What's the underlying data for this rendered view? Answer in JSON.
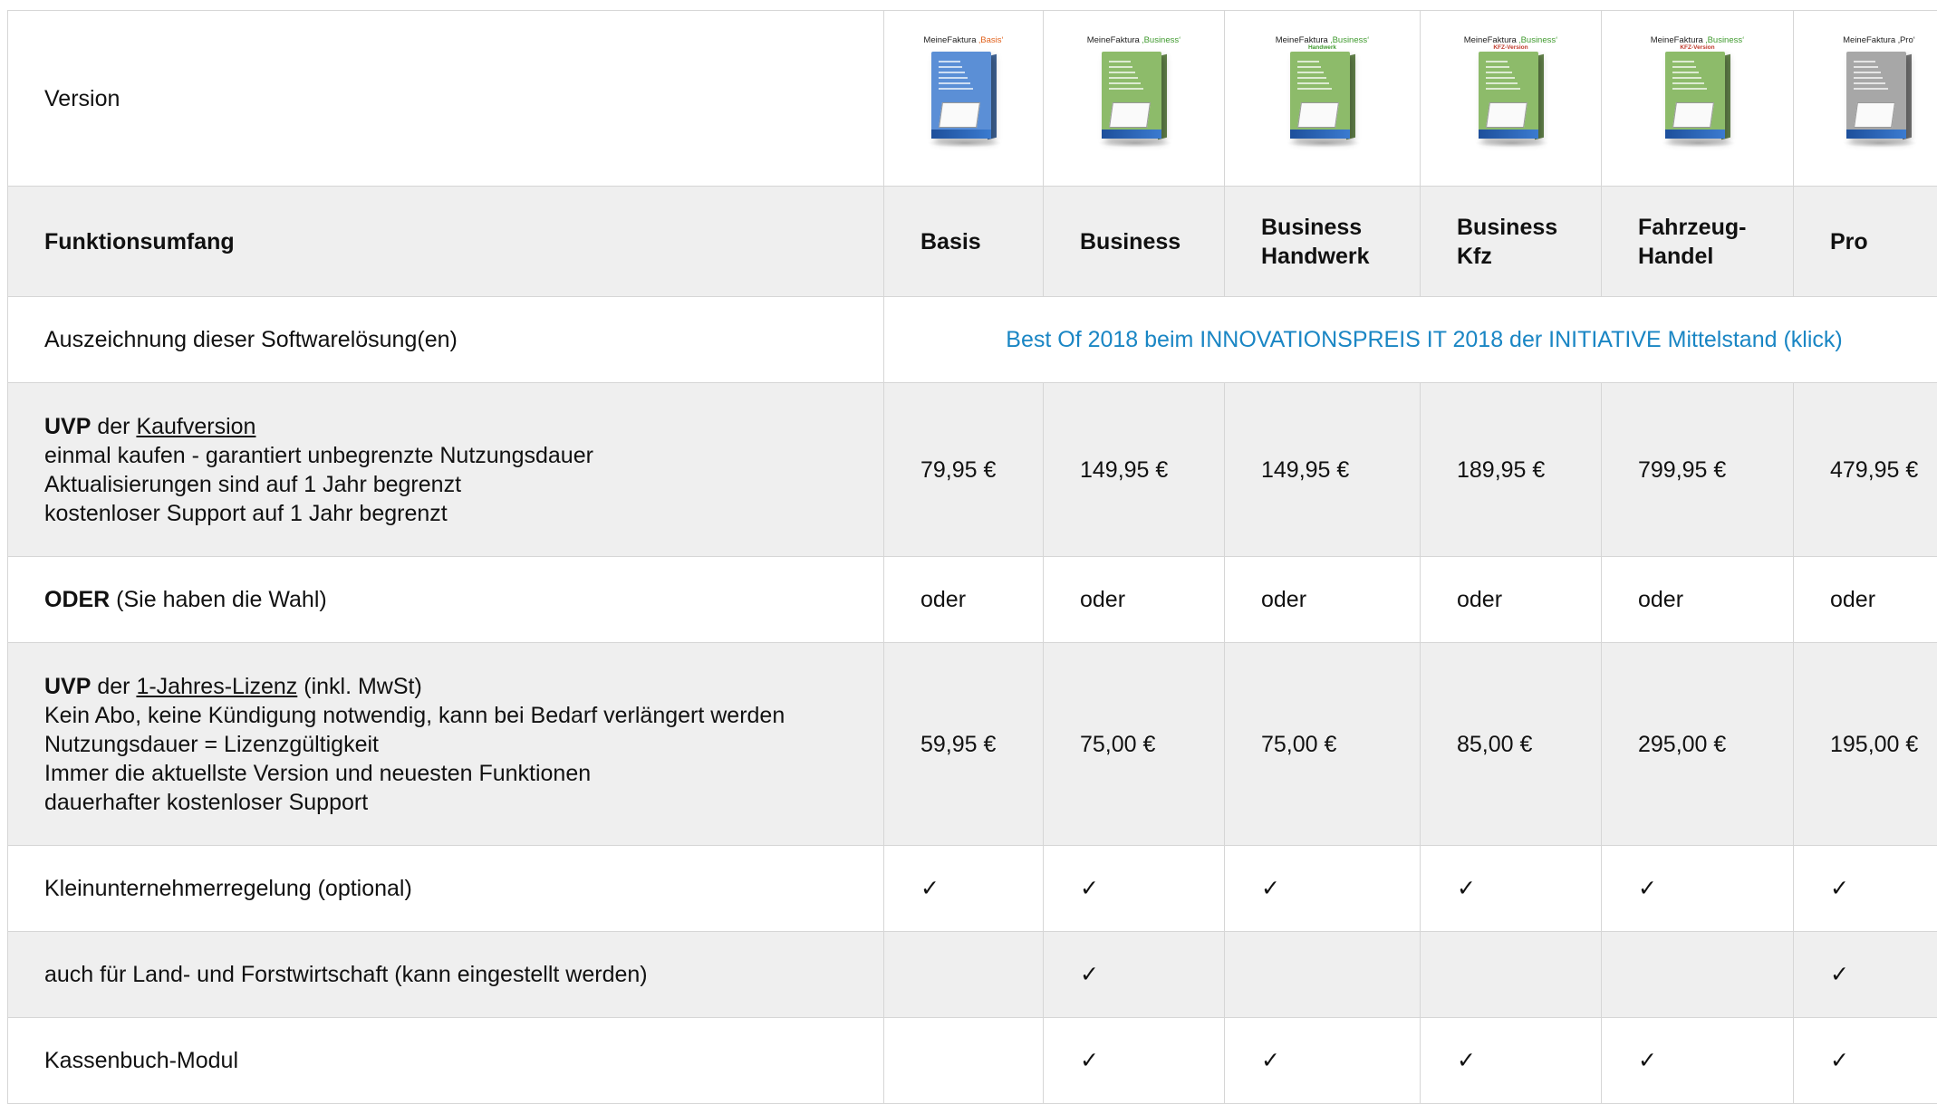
{
  "table": {
    "version_label": "Version",
    "products": [
      {
        "box_title": "MeineFaktura",
        "box_edition": "‚Basis‘",
        "box_sub": "",
        "color": "#5b8fd6",
        "edition_color": "#e0601a",
        "sub_color": ""
      },
      {
        "box_title": "MeineFaktura",
        "box_edition": "‚Business‘",
        "box_sub": "",
        "color": "#8dbb6a",
        "edition_color": "#3f9a2e",
        "sub_color": ""
      },
      {
        "box_title": "MeineFaktura",
        "box_edition": "‚Business‘",
        "box_sub": "Handwerk",
        "color": "#8dbb6a",
        "edition_color": "#3f9a2e",
        "sub_color": "#3f9a2e"
      },
      {
        "box_title": "MeineFaktura",
        "box_edition": "‚Business‘",
        "box_sub": "KFZ-Version",
        "color": "#8dbb6a",
        "edition_color": "#3f9a2e",
        "sub_color": "#c0392b"
      },
      {
        "box_title": "MeineFaktura",
        "box_edition": "‚Business‘",
        "box_sub": "KFZ-Version",
        "color": "#8dbb6a",
        "edition_color": "#3f9a2e",
        "sub_color": "#c0392b"
      },
      {
        "box_title": "MeineFaktura",
        "box_edition": "‚Pro‘",
        "box_sub": "",
        "color": "#a7a7a7",
        "edition_color": "#222222",
        "sub_color": ""
      }
    ],
    "header_label": "Funktionsumfang",
    "columns": [
      {
        "line1": "Basis",
        "line2": ""
      },
      {
        "line1": "Business",
        "line2": ""
      },
      {
        "line1": "Business",
        "line2": "Handwerk"
      },
      {
        "line1": "Business",
        "line2": "Kfz"
      },
      {
        "line1": "Fahrzeug-",
        "line2": "Handel"
      },
      {
        "line1": "Pro",
        "line2": ""
      }
    ],
    "award": {
      "label": "Auszeichnung dieser Softwarelösung(en)",
      "link_text": "Best Of 2018 beim INNOVATIONSPREIS IT 2018 der INITIATIVE Mittelstand (klick)"
    },
    "kaufversion": {
      "bold": "UVP",
      "mid": " der ",
      "link": "Kaufversion",
      "lines": [
        "einmal kaufen - garantiert unbegrenzte Nutzungsdauer",
        "Aktualisierungen sind auf 1 Jahr begrenzt",
        "kostenloser Support auf 1 Jahr begrenzt"
      ],
      "prices": [
        "79,95 €",
        "149,95 €",
        "149,95 €",
        "189,95 €",
        "799,95 €",
        "479,95 €"
      ]
    },
    "oder": {
      "bold": "ODER",
      "rest": " (Sie haben die Wahl)",
      "values": [
        "oder",
        "oder",
        "oder",
        "oder",
        "oder",
        "oder"
      ]
    },
    "lizenz": {
      "bold": "UVP",
      "mid": " der ",
      "link": "1-Jahres-Lizenz",
      "after": " (inkl. MwSt)",
      "lines": [
        "Kein Abo, keine Kündigung notwendig, kann bei Bedarf verlängert werden",
        "Nutzungsdauer = Lizenzgültigkeit",
        "Immer die aktuellste Version und neuesten Funktionen",
        "dauerhafter kostenloser Support"
      ],
      "prices": [
        "59,95 €",
        "75,00 €",
        "75,00 €",
        "85,00 €",
        "295,00 €",
        "195,00 €"
      ]
    },
    "features": [
      {
        "label": "Kleinunternehmerregelung (optional)",
        "marks": [
          "✓",
          "✓",
          "✓",
          "✓",
          "✓",
          "✓"
        ]
      },
      {
        "label": "auch für Land- und Forstwirtschaft (kann eingestellt werden)",
        "marks": [
          "",
          "✓",
          "",
          "",
          "",
          "✓"
        ]
      },
      {
        "label": "Kassenbuch-Modul",
        "marks": [
          "",
          "✓",
          "✓",
          "✓",
          "✓",
          "✓"
        ]
      }
    ]
  }
}
